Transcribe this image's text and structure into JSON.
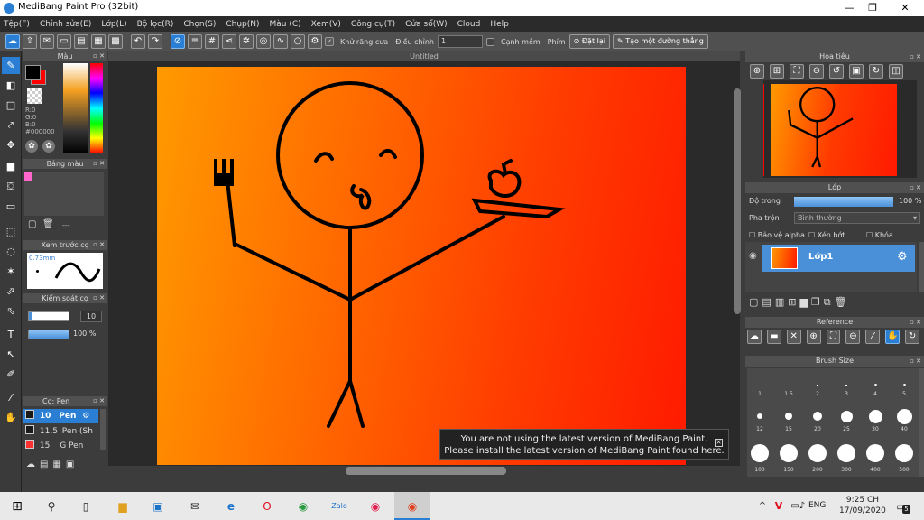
{
  "window": {
    "title": "MediBang Paint Pro (32bit)",
    "minimize": "—",
    "maximize": "❐",
    "close": "✕"
  },
  "menu": [
    "Tệp(F)",
    "Chỉnh sửa(E)",
    "Lớp(L)",
    "Bộ lọc(R)",
    "Chọn(S)",
    "Chụp(N)",
    "Màu (C)",
    "Xem(V)",
    "Công cụ(T)",
    "Cửa sổ(W)",
    "Cloud",
    "Help"
  ],
  "toolbar": {
    "antialias_label": "Khử răng cưa",
    "adjust_label": "Điều chỉnh",
    "adjust_value": "1",
    "smooth_label": "Cạnh mềm",
    "key_label": "Phím",
    "reset_label": "Đặt lại",
    "straight_label": "Tạo một đường thẳng"
  },
  "color_panel": {
    "title": "Màu",
    "r": "R:0",
    "g": "G:0",
    "b": "B:0",
    "hex": "#000000",
    "primary": "#000000",
    "secondary": "#ff0000"
  },
  "swatch_panel": {
    "title": "Bảng màu",
    "swatch": "#ff66cc",
    "dash": "---"
  },
  "brush_preview": {
    "title": "Xem trước cọ",
    "size": "0.73mm"
  },
  "brush_control": {
    "title": "Kiểm soát cọ",
    "size_value": "10",
    "opacity_value": "100 %"
  },
  "brush_list": {
    "title": "Cọ: Pen",
    "items": [
      {
        "size": "10",
        "name": "Pen",
        "color": "#1a1a1a"
      },
      {
        "size": "11.5",
        "name": "Pen (Sh",
        "color": "#1a1a1a"
      },
      {
        "size": "15",
        "name": "G Pen",
        "color": "#ff3030"
      }
    ]
  },
  "canvas": {
    "doc_title": "Untitled"
  },
  "notification": {
    "line1": "You are not using the latest version of MediBang Paint.",
    "line2": "Please install the latest version of MediBang Paint found here.",
    "close": "✕"
  },
  "navigator": {
    "title": "Hoa tiêu"
  },
  "layer_panel": {
    "title": "Lớp",
    "opacity_label": "Độ trong",
    "opacity_value": "100 %",
    "blend_label": "Pha trộn",
    "blend_value": "Bình thường",
    "protect_alpha": "Bảo vệ alpha",
    "clipping": "Xén bớt",
    "lock": "Khóa",
    "layer_name": "Lớp1"
  },
  "reference_panel": {
    "title": "Reference"
  },
  "brush_size_panel": {
    "title": "Brush Size",
    "row1": [
      "1",
      "1.5",
      "2",
      "3",
      "4",
      "5"
    ],
    "row2": [
      "12",
      "15",
      "20",
      "25",
      "30",
      "40"
    ],
    "row3": [
      "100",
      "150",
      "200",
      "300",
      "400",
      "500"
    ]
  },
  "taskbar": {
    "lang": "ENG",
    "time": "9:25 CH",
    "date": "17/09/2020",
    "notif": "5"
  }
}
